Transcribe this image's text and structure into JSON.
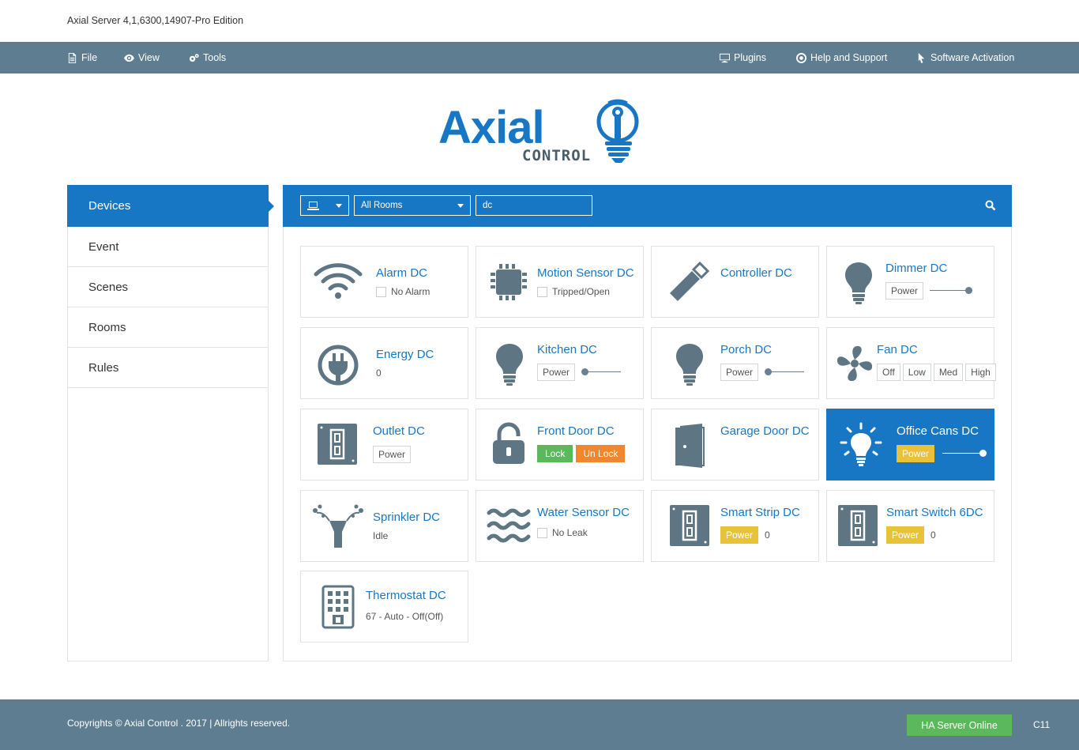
{
  "app_title": "Axial Server 4,1,6300,14907-Pro Edition",
  "menu": {
    "file": "File",
    "view": "View",
    "tools": "Tools",
    "plugins": "Plugins",
    "help": "Help and Support",
    "activation": "Software Activation"
  },
  "logo": {
    "word": "Axial",
    "sub": "CONTROL",
    "brand_color": "#1777c4"
  },
  "sidebar": {
    "items": [
      {
        "label": "Devices",
        "active": true
      },
      {
        "label": "Event"
      },
      {
        "label": "Scenes"
      },
      {
        "label": "Rooms"
      },
      {
        "label": "Rules"
      }
    ]
  },
  "toolbar": {
    "device_type_icon": "laptop-icon",
    "room_select": "All Rooms",
    "search_value": "dc"
  },
  "devices": {
    "alarm": {
      "name": "Alarm DC",
      "status": "No Alarm"
    },
    "motion": {
      "name": "Motion Sensor DC",
      "status": "Tripped/Open"
    },
    "controller": {
      "name": "Controller DC"
    },
    "dimmer": {
      "name": "Dimmer DC",
      "power": "Power",
      "level": 1.0
    },
    "energy": {
      "name": "Energy DC",
      "value": "0"
    },
    "kitchen": {
      "name": "Kitchen DC",
      "power": "Power",
      "level": 0.0
    },
    "porch": {
      "name": "Porch DC",
      "power": "Power",
      "level": 0.0
    },
    "fan": {
      "name": "Fan DC",
      "speeds": [
        "Off",
        "Low",
        "Med",
        "High"
      ]
    },
    "outlet": {
      "name": "Outlet DC",
      "power": "Power"
    },
    "front_door": {
      "name": "Front Door DC",
      "lock": "Lock",
      "unlock": "Un Lock"
    },
    "garage": {
      "name": "Garage Door DC"
    },
    "office": {
      "name": "Office Cans DC",
      "power": "Power",
      "level": 1.0
    },
    "sprinkler": {
      "name": "Sprinkler DC",
      "status": "Idle"
    },
    "water": {
      "name": "Water Sensor DC",
      "status": "No Leak"
    },
    "strip": {
      "name": "Smart Strip DC",
      "power": "Power",
      "value": "0"
    },
    "switch6": {
      "name": "Smart Switch 6DC",
      "power": "Power",
      "value": "0"
    },
    "thermostat": {
      "name": "Thermostat DC",
      "status": "67 - Auto - Off(Off)"
    }
  },
  "footer": {
    "copyright": "Copyrights © Axial Control . 2017 | Allrights reserved.",
    "status": "HA Server Online",
    "code": "C11"
  },
  "colors": {
    "accent": "#1777c4",
    "bar": "#5e7d91",
    "icon": "#5e7584",
    "yellow": "#e9c23a",
    "green": "#5cb85c",
    "orange": "#f0872e"
  }
}
